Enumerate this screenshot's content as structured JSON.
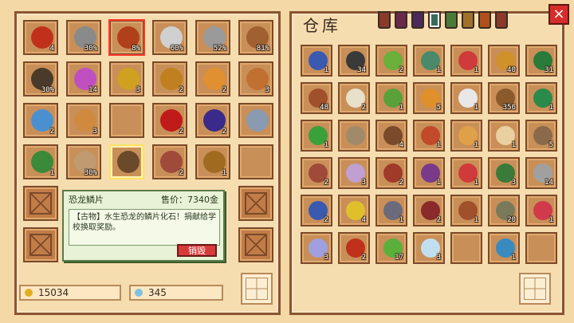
{
  "storage": {
    "title": "仓库",
    "tab_colors": [
      "#8a3a2a",
      "#6a2a4a",
      "#4a2a5a",
      "#3a6a5a",
      "#4a7a3a",
      "#a0702a",
      "#b0501a",
      "#8a3a2a"
    ]
  },
  "inventory": {
    "slots": [
      {
        "icon": "chili-pepper-icon",
        "color": "#c0301a",
        "qty": "4",
        "state": "item"
      },
      {
        "icon": "axe-icon",
        "color": "#8a8a8a",
        "qty": "30%",
        "state": "item"
      },
      {
        "icon": "red-axe-icon",
        "color": "#b0401a",
        "qty": "8%",
        "state": "selected"
      },
      {
        "icon": "scythe-icon",
        "color": "#d0d0d0",
        "qty": "60%",
        "state": "item"
      },
      {
        "icon": "pickaxe-icon",
        "color": "#9a9a9a",
        "qty": "52%",
        "state": "item"
      },
      {
        "icon": "hoe-icon",
        "color": "#a06030",
        "qty": "81%",
        "state": "item"
      },
      {
        "icon": "pickaxe-dark-icon",
        "color": "#4a3a2a",
        "qty": "30%",
        "state": "item"
      },
      {
        "icon": "purple-gem-icon",
        "color": "#c050c0",
        "qty": "14",
        "state": "item"
      },
      {
        "icon": "wheat-icon",
        "color": "#d0a020",
        "qty": "3",
        "state": "item"
      },
      {
        "icon": "ornament-icon",
        "color": "#c08020",
        "qty": "2",
        "state": "item"
      },
      {
        "icon": "straw-hat-icon",
        "color": "#e09030",
        "qty": "2",
        "state": "item"
      },
      {
        "icon": "cone-icon",
        "color": "#c07030",
        "qty": "3",
        "state": "item"
      },
      {
        "icon": "blue-fish-icon",
        "color": "#4a90d0",
        "qty": "2",
        "state": "item"
      },
      {
        "icon": "bread-icon",
        "color": "#d08a40",
        "qty": "3",
        "state": "item"
      },
      {
        "icon": "",
        "color": "",
        "qty": "",
        "state": "empty"
      },
      {
        "icon": "cherry-icon",
        "color": "#c01a1a",
        "qty": "2",
        "state": "item"
      },
      {
        "icon": "sea-urchin-icon",
        "color": "#3a2a8a",
        "qty": "2",
        "state": "item"
      },
      {
        "icon": "sword-icon",
        "color": "#8a9ab0",
        "qty": "",
        "state": "item"
      },
      {
        "icon": "seaweed-icon",
        "color": "#3a8a3a",
        "qty": "1",
        "state": "item"
      },
      {
        "icon": "bow-icon",
        "color": "#c09a70",
        "qty": "30%",
        "state": "item"
      },
      {
        "icon": "dinosaur-scale-icon",
        "color": "#6a4a2a",
        "qty": "",
        "state": "highlight"
      },
      {
        "icon": "fossil-icon",
        "color": "#a04a3a",
        "qty": "2",
        "state": "item"
      },
      {
        "icon": "acorn-icon",
        "color": "#a06a20",
        "qty": "1",
        "state": "item"
      },
      {
        "icon": "",
        "color": "",
        "qty": "",
        "state": "empty"
      },
      {
        "icon": "",
        "color": "",
        "qty": "",
        "state": "locked"
      },
      {
        "icon": "",
        "color": "",
        "qty": "",
        "state": "hidden"
      },
      {
        "icon": "",
        "color": "",
        "qty": "",
        "state": "hidden"
      },
      {
        "icon": "",
        "color": "",
        "qty": "",
        "state": "hidden"
      },
      {
        "icon": "",
        "color": "",
        "qty": "",
        "state": "hidden"
      },
      {
        "icon": "",
        "color": "",
        "qty": "",
        "state": "locked"
      },
      {
        "icon": "",
        "color": "",
        "qty": "",
        "state": "locked"
      },
      {
        "icon": "",
        "color": "",
        "qty": "",
        "state": "hidden"
      },
      {
        "icon": "",
        "color": "",
        "qty": "",
        "state": "hidden"
      },
      {
        "icon": "",
        "color": "",
        "qty": "",
        "state": "hidden"
      },
      {
        "icon": "",
        "color": "",
        "qty": "",
        "state": "hidden"
      },
      {
        "icon": "",
        "color": "",
        "qty": "",
        "state": "locked"
      }
    ]
  },
  "warehouse": {
    "slots": [
      {
        "icon": "fishing-rod-icon",
        "color": "#3a5ab0",
        "qty": "1"
      },
      {
        "icon": "coal-icon",
        "color": "#3a3a3a",
        "qty": "34"
      },
      {
        "icon": "green-leaf-icon",
        "color": "#6ab03a",
        "qty": "2"
      },
      {
        "icon": "shovel-icon",
        "color": "#4a8a6a",
        "qty": "1"
      },
      {
        "icon": "rose-icon",
        "color": "#d03a3a",
        "qty": "1"
      },
      {
        "icon": "oil-lamp-icon",
        "color": "#d0902a",
        "qty": "40"
      },
      {
        "icon": "seaweed-icon",
        "color": "#2a7a3a",
        "qty": "31"
      },
      {
        "icon": "wood-log-icon",
        "color": "#a0502a",
        "qty": "48"
      },
      {
        "icon": "cauliflower-icon",
        "color": "#e8e0c8",
        "qty": "2"
      },
      {
        "icon": "green-fish-icon",
        "color": "#5aa03a",
        "qty": "1"
      },
      {
        "icon": "honeycomb-icon",
        "color": "#e0902a",
        "qty": "5"
      },
      {
        "icon": "feather-icon",
        "color": "#e8e8e8",
        "qty": "1"
      },
      {
        "icon": "wooden-branch-icon",
        "color": "#8a5a2a",
        "qty": "356"
      },
      {
        "icon": "kelp-icon",
        "color": "#2a8a4a",
        "qty": "1"
      },
      {
        "icon": "green-battery-icon",
        "color": "#3aa03a",
        "qty": "1"
      },
      {
        "icon": "net-icon",
        "color": "#a08a6a",
        "qty": ""
      },
      {
        "icon": "branch-icon",
        "color": "#7a4a2a",
        "qty": "4"
      },
      {
        "icon": "salad-icon",
        "color": "#c04a2a",
        "qty": "1"
      },
      {
        "icon": "pizza-icon",
        "color": "#e0a04a",
        "qty": "1"
      },
      {
        "icon": "pie-slice-icon",
        "color": "#e8d0a0",
        "qty": "1"
      },
      {
        "icon": "brown-rock-icon",
        "color": "#8a6a4a",
        "qty": "5"
      },
      {
        "icon": "fossil-icon",
        "color": "#a04a3a",
        "qty": "2"
      },
      {
        "icon": "shell-icon",
        "color": "#c0a0d0",
        "qty": "3"
      },
      {
        "icon": "pomegranate-icon",
        "color": "#a03a2a",
        "qty": "2"
      },
      {
        "icon": "potion-jar-icon",
        "color": "#7a3a8a",
        "qty": "1"
      },
      {
        "icon": "magic-rose-icon",
        "color": "#d03a3a",
        "qty": "1"
      },
      {
        "icon": "green-pouch-icon",
        "color": "#3a7a3a",
        "qty": "3"
      },
      {
        "icon": "silver-rock-icon",
        "color": "#a0a0a0",
        "qty": "14"
      },
      {
        "icon": "blue-crystal-icon",
        "color": "#3a5ab0",
        "qty": "2"
      },
      {
        "icon": "calla-lily-icon",
        "color": "#e0c02a",
        "qty": "4"
      },
      {
        "icon": "iron-ore-icon",
        "color": "#6a6a7a",
        "qty": "1"
      },
      {
        "icon": "meat-icon",
        "color": "#8a2a2a",
        "qty": "2"
      },
      {
        "icon": "bottle-icon",
        "color": "#a0502a",
        "qty": "1"
      },
      {
        "icon": "mossy-rock-icon",
        "color": "#7a7a5a",
        "qty": "20"
      },
      {
        "icon": "red-potion-icon",
        "color": "#d03a4a",
        "qty": "1"
      },
      {
        "icon": "sparkle-icon",
        "color": "#a0a0e0",
        "qty": "3"
      },
      {
        "icon": "chili-pepper-icon",
        "color": "#c0301a",
        "qty": "2"
      },
      {
        "icon": "green-bug-icon",
        "color": "#5ab03a",
        "qty": "17"
      },
      {
        "icon": "diamond-icon",
        "color": "#c0e0f0",
        "qty": "3"
      },
      {
        "icon": "",
        "color": "",
        "qty": ""
      },
      {
        "icon": "map-icon",
        "color": "#3a8ac0",
        "qty": "1"
      },
      {
        "icon": "",
        "color": "",
        "qty": ""
      }
    ]
  },
  "wallet": {
    "gold": "15034",
    "gold_color": "#e0b020",
    "gems": "345",
    "gem_color": "#80c0e0"
  },
  "tooltip": {
    "name": "恐龙鳞片",
    "price_label": "售价：7340金",
    "description": "【古物】水生恐龙的鳞片化石！捐献给学校换取奖励。",
    "destroy_label": "销毁"
  },
  "close_label": "×"
}
